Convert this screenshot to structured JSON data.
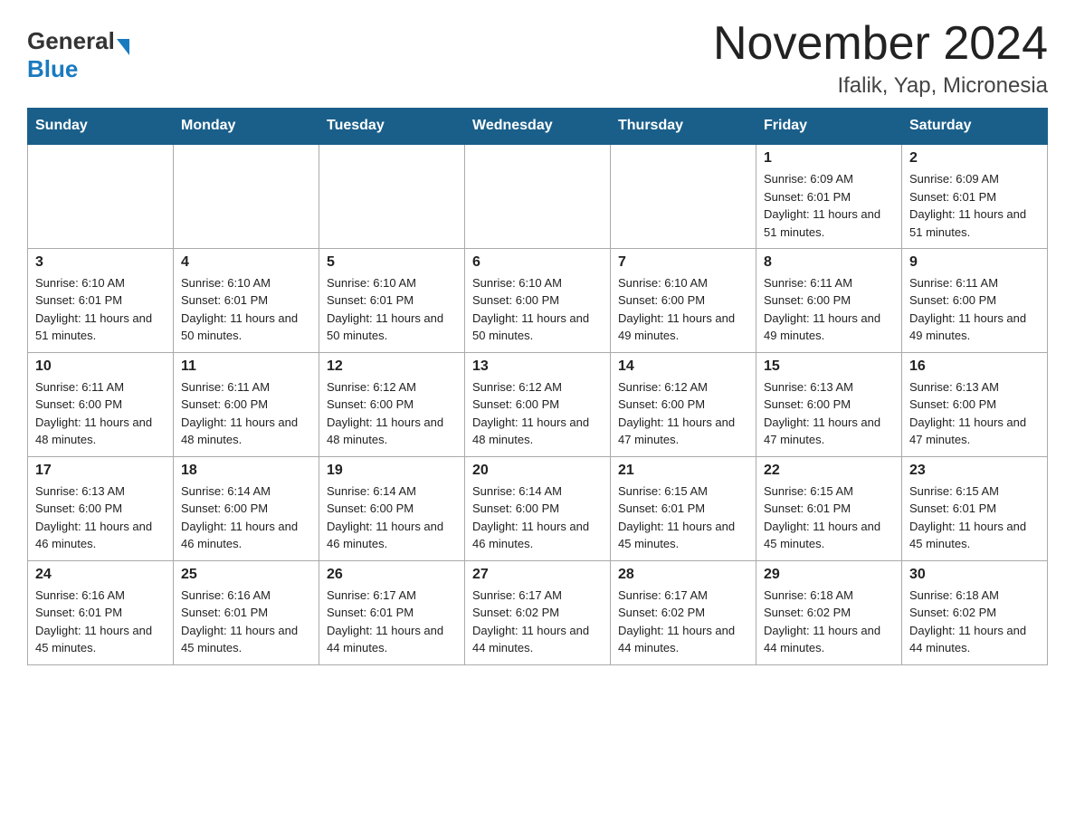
{
  "header": {
    "logo": {
      "general": "General",
      "blue": "Blue"
    },
    "month_title": "November 2024",
    "location": "Ifalik, Yap, Micronesia"
  },
  "calendar": {
    "days_of_week": [
      "Sunday",
      "Monday",
      "Tuesday",
      "Wednesday",
      "Thursday",
      "Friday",
      "Saturday"
    ],
    "weeks": [
      [
        {
          "day": "",
          "info": ""
        },
        {
          "day": "",
          "info": ""
        },
        {
          "day": "",
          "info": ""
        },
        {
          "day": "",
          "info": ""
        },
        {
          "day": "",
          "info": ""
        },
        {
          "day": "1",
          "info": "Sunrise: 6:09 AM\nSunset: 6:01 PM\nDaylight: 11 hours and 51 minutes."
        },
        {
          "day": "2",
          "info": "Sunrise: 6:09 AM\nSunset: 6:01 PM\nDaylight: 11 hours and 51 minutes."
        }
      ],
      [
        {
          "day": "3",
          "info": "Sunrise: 6:10 AM\nSunset: 6:01 PM\nDaylight: 11 hours and 51 minutes."
        },
        {
          "day": "4",
          "info": "Sunrise: 6:10 AM\nSunset: 6:01 PM\nDaylight: 11 hours and 50 minutes."
        },
        {
          "day": "5",
          "info": "Sunrise: 6:10 AM\nSunset: 6:01 PM\nDaylight: 11 hours and 50 minutes."
        },
        {
          "day": "6",
          "info": "Sunrise: 6:10 AM\nSunset: 6:00 PM\nDaylight: 11 hours and 50 minutes."
        },
        {
          "day": "7",
          "info": "Sunrise: 6:10 AM\nSunset: 6:00 PM\nDaylight: 11 hours and 49 minutes."
        },
        {
          "day": "8",
          "info": "Sunrise: 6:11 AM\nSunset: 6:00 PM\nDaylight: 11 hours and 49 minutes."
        },
        {
          "day": "9",
          "info": "Sunrise: 6:11 AM\nSunset: 6:00 PM\nDaylight: 11 hours and 49 minutes."
        }
      ],
      [
        {
          "day": "10",
          "info": "Sunrise: 6:11 AM\nSunset: 6:00 PM\nDaylight: 11 hours and 48 minutes."
        },
        {
          "day": "11",
          "info": "Sunrise: 6:11 AM\nSunset: 6:00 PM\nDaylight: 11 hours and 48 minutes."
        },
        {
          "day": "12",
          "info": "Sunrise: 6:12 AM\nSunset: 6:00 PM\nDaylight: 11 hours and 48 minutes."
        },
        {
          "day": "13",
          "info": "Sunrise: 6:12 AM\nSunset: 6:00 PM\nDaylight: 11 hours and 48 minutes."
        },
        {
          "day": "14",
          "info": "Sunrise: 6:12 AM\nSunset: 6:00 PM\nDaylight: 11 hours and 47 minutes."
        },
        {
          "day": "15",
          "info": "Sunrise: 6:13 AM\nSunset: 6:00 PM\nDaylight: 11 hours and 47 minutes."
        },
        {
          "day": "16",
          "info": "Sunrise: 6:13 AM\nSunset: 6:00 PM\nDaylight: 11 hours and 47 minutes."
        }
      ],
      [
        {
          "day": "17",
          "info": "Sunrise: 6:13 AM\nSunset: 6:00 PM\nDaylight: 11 hours and 46 minutes."
        },
        {
          "day": "18",
          "info": "Sunrise: 6:14 AM\nSunset: 6:00 PM\nDaylight: 11 hours and 46 minutes."
        },
        {
          "day": "19",
          "info": "Sunrise: 6:14 AM\nSunset: 6:00 PM\nDaylight: 11 hours and 46 minutes."
        },
        {
          "day": "20",
          "info": "Sunrise: 6:14 AM\nSunset: 6:00 PM\nDaylight: 11 hours and 46 minutes."
        },
        {
          "day": "21",
          "info": "Sunrise: 6:15 AM\nSunset: 6:01 PM\nDaylight: 11 hours and 45 minutes."
        },
        {
          "day": "22",
          "info": "Sunrise: 6:15 AM\nSunset: 6:01 PM\nDaylight: 11 hours and 45 minutes."
        },
        {
          "day": "23",
          "info": "Sunrise: 6:15 AM\nSunset: 6:01 PM\nDaylight: 11 hours and 45 minutes."
        }
      ],
      [
        {
          "day": "24",
          "info": "Sunrise: 6:16 AM\nSunset: 6:01 PM\nDaylight: 11 hours and 45 minutes."
        },
        {
          "day": "25",
          "info": "Sunrise: 6:16 AM\nSunset: 6:01 PM\nDaylight: 11 hours and 45 minutes."
        },
        {
          "day": "26",
          "info": "Sunrise: 6:17 AM\nSunset: 6:01 PM\nDaylight: 11 hours and 44 minutes."
        },
        {
          "day": "27",
          "info": "Sunrise: 6:17 AM\nSunset: 6:02 PM\nDaylight: 11 hours and 44 minutes."
        },
        {
          "day": "28",
          "info": "Sunrise: 6:17 AM\nSunset: 6:02 PM\nDaylight: 11 hours and 44 minutes."
        },
        {
          "day": "29",
          "info": "Sunrise: 6:18 AM\nSunset: 6:02 PM\nDaylight: 11 hours and 44 minutes."
        },
        {
          "day": "30",
          "info": "Sunrise: 6:18 AM\nSunset: 6:02 PM\nDaylight: 11 hours and 44 minutes."
        }
      ]
    ]
  }
}
